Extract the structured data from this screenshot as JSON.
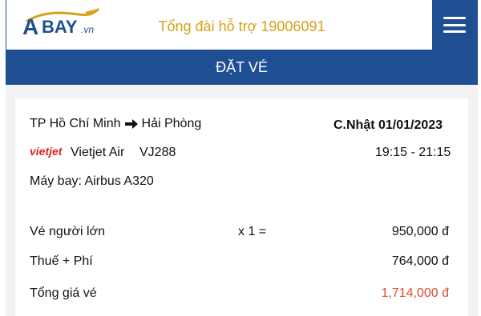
{
  "header": {
    "logo_text": "ABAY.vn",
    "hotline": "Tổng đài hỗ trợ 19006091",
    "menu_icon": "hamburger-icon"
  },
  "title": "ĐẶT VÉ",
  "flight": {
    "from": "TP Hồ Chí Minh",
    "to": "Hải Phòng",
    "date": "C.Nhật  01/01/2023",
    "airline_logo": "vietjet",
    "airline": "Vietjet Air",
    "flight_no": "VJ288",
    "time": "19:15 - 21:15",
    "aircraft": "Máy bay: Airbus A320"
  },
  "pricing": {
    "adult_label": "Vé người lớn",
    "adult_qty": "x 1 =",
    "adult_price": "950,000 đ",
    "tax_label": "Thuế + Phí",
    "tax_price": "764,000 đ",
    "total_label": "Tổng giá vé",
    "total_price": "1,714,000 đ"
  },
  "colors": {
    "primary": "#1f4f92",
    "accent": "#d6a11a",
    "total": "#e04a2f"
  }
}
